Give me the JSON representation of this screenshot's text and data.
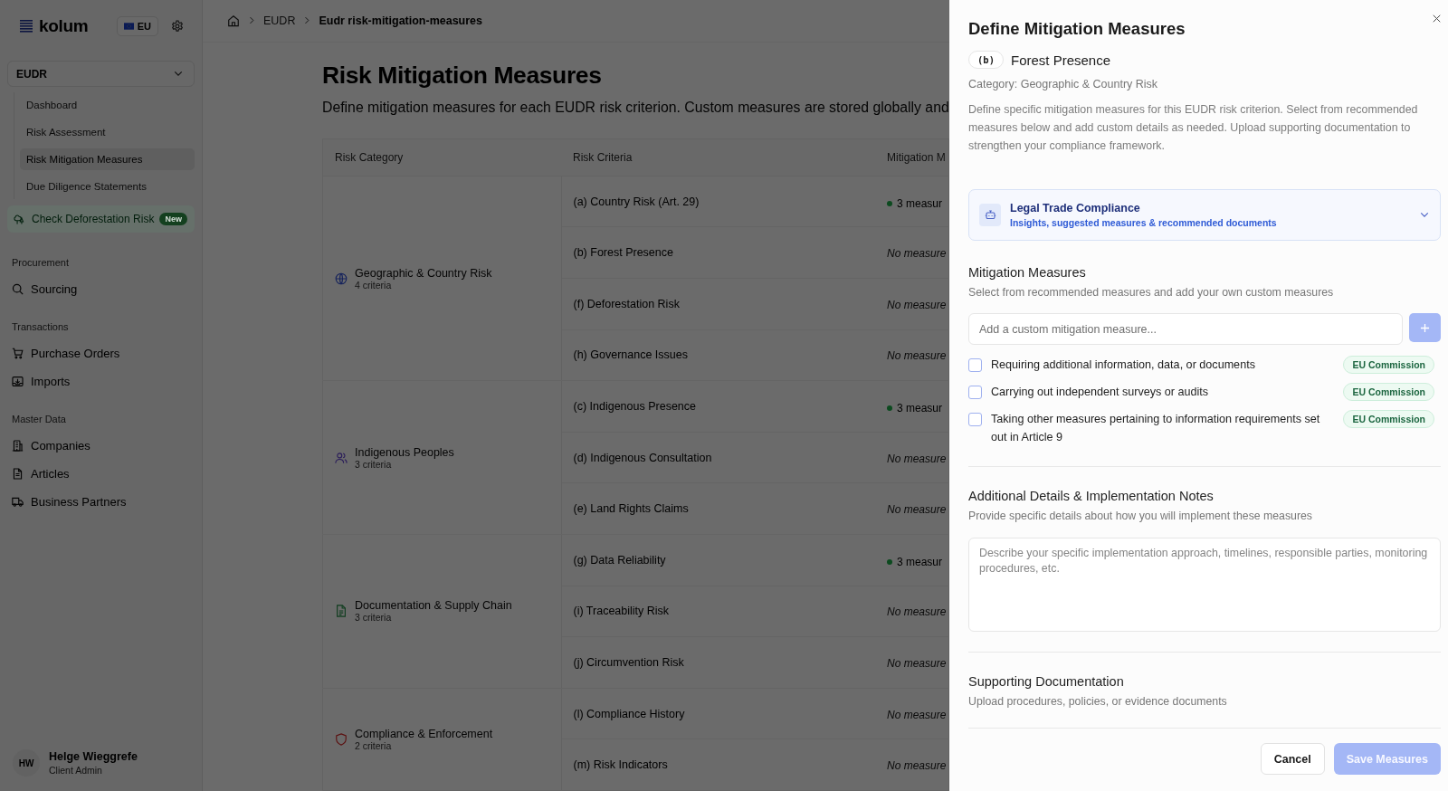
{
  "sidebar": {
    "logo": "kolum",
    "region": "EU",
    "module": {
      "label": "EUDR",
      "expanded": true,
      "items": [
        {
          "label": "Dashboard",
          "selected": false
        },
        {
          "label": "Risk Assessment",
          "selected": false
        },
        {
          "label": "Risk Mitigation Measures",
          "selected": true
        },
        {
          "label": "Due Diligence Statements",
          "selected": false
        }
      ]
    },
    "promo": {
      "label": "Check Deforestation Risk",
      "badge": "New"
    },
    "sections": [
      {
        "title": "Procurement",
        "items": [
          {
            "label": "Sourcing"
          }
        ]
      },
      {
        "title": "Transactions",
        "items": [
          {
            "label": "Purchase Orders"
          },
          {
            "label": "Imports"
          }
        ]
      },
      {
        "title": "Master Data",
        "items": [
          {
            "label": "Companies"
          },
          {
            "label": "Articles"
          },
          {
            "label": "Business Partners"
          }
        ]
      }
    ],
    "user": {
      "initials": "HW",
      "name": "Helge Wieggrefe",
      "role": "Client Admin"
    }
  },
  "breadcrumb": [
    "EUDR",
    "Eudr risk-mitigation-measures"
  ],
  "page": {
    "title": "Risk Mitigation Measures",
    "subtitle": "Define mitigation measures for each EUDR risk criterion. Custom measures are stored globally and"
  },
  "table": {
    "columns": [
      "Risk Category",
      "Risk Criteria",
      "Mitigation M"
    ],
    "groups": [
      {
        "category": "Geographic & Country Risk",
        "count": "4 criteria",
        "rows": [
          {
            "criterion": "(a) Country Risk (Art. 29)",
            "measures": "3 measur",
            "has_measures": true
          },
          {
            "criterion": "(b) Forest Presence",
            "measures": "No measure",
            "has_measures": false
          },
          {
            "criterion": "(f) Deforestation Risk",
            "measures": "No measure",
            "has_measures": false
          },
          {
            "criterion": "(h) Governance Issues",
            "measures": "No measure",
            "has_measures": false
          }
        ]
      },
      {
        "category": "Indigenous Peoples",
        "count": "3 criteria",
        "rows": [
          {
            "criterion": "(c) Indigenous Presence",
            "measures": "3 measur",
            "has_measures": true
          },
          {
            "criterion": "(d) Indigenous Consultation",
            "measures": "No measure",
            "has_measures": false
          },
          {
            "criterion": "(e) Land Rights Claims",
            "measures": "No measure",
            "has_measures": false
          }
        ]
      },
      {
        "category": "Documentation & Supply Chain",
        "count": "3 criteria",
        "rows": [
          {
            "criterion": "(g) Data Reliability",
            "measures": "3 measur",
            "has_measures": true
          },
          {
            "criterion": "(i) Traceability Risk",
            "measures": "No measure",
            "has_measures": false
          },
          {
            "criterion": "(j) Circumvention Risk",
            "measures": "No measure",
            "has_measures": false
          }
        ]
      },
      {
        "category": "Compliance & Enforcement",
        "count": "2 criteria",
        "rows": [
          {
            "criterion": "(l) Compliance History",
            "measures": "No measure",
            "has_measures": false
          },
          {
            "criterion": "(m) Risk Indicators",
            "measures": "No measure",
            "has_measures": false
          }
        ]
      }
    ]
  },
  "panel": {
    "title": "Define Mitigation Measures",
    "code": "(b)",
    "criterion": "Forest Presence",
    "category": "Category: Geographic & Country Risk",
    "description": "Define specific mitigation measures for this EUDR risk criterion. Select from recommended measures below and add custom details as needed. Upload supporting documentation to strengthen your compliance framework.",
    "insight_card": {
      "title": "Legal Trade Compliance",
      "subtitle": "Insights, suggested measures & recommended documents",
      "expanded": false
    },
    "measures_section": {
      "title": "Mitigation Measures",
      "subtitle": "Select from recommended measures and add your own custom measures",
      "input": {
        "placeholder": "Add a custom mitigation measure..."
      },
      "add_button": {
        "disabled": true
      },
      "measures": [
        {
          "label": "Requiring additional information, data, or documents",
          "source": "EU Commission",
          "checked": false
        },
        {
          "label": "Carrying out independent surveys or audits",
          "source": "EU Commission",
          "checked": false
        },
        {
          "label": "Taking other measures pertaining to information requirements set out in Article 9",
          "source": "EU Commission",
          "checked": false
        }
      ]
    },
    "notes_section": {
      "title": "Additional Details & Implementation Notes",
      "subtitle": "Provide specific details about how you will implement these measures",
      "textarea": {
        "placeholder": "Describe your specific implementation approach, timelines, responsible parties, monitoring procedures, etc."
      }
    },
    "docs_section": {
      "title": "Supporting Documentation",
      "subtitle": "Upload procedures, policies, or evidence documents"
    },
    "buttons": [
      {
        "label": "Cancel",
        "kind": "secondary",
        "disabled": false
      },
      {
        "label": "Save Measures",
        "kind": "primary",
        "disabled": true
      }
    ]
  }
}
